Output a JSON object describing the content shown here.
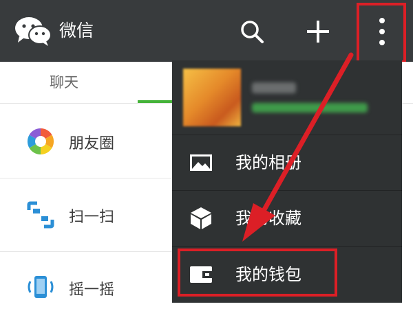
{
  "app": {
    "title": "微信"
  },
  "toolbar": {
    "icons": [
      "search-icon",
      "plus-icon",
      "more-vertical-icon"
    ]
  },
  "tabs": {
    "chat_label": "聊天"
  },
  "discover": {
    "items": [
      {
        "label": "朋友圈",
        "icon": "moments-icon"
      },
      {
        "label": "扫一扫",
        "icon": "scan-icon"
      },
      {
        "label": "摇一摇",
        "icon": "shake-icon"
      }
    ]
  },
  "menu": {
    "items": [
      {
        "label": "我的相册",
        "icon": "photo-album-icon"
      },
      {
        "label": "我的收藏",
        "icon": "favorites-cube-icon"
      },
      {
        "label": "我的钱包",
        "icon": "wallet-icon"
      }
    ]
  },
  "colors": {
    "appbar": "#383b3d",
    "menu": "#2f3233",
    "accent_green": "#45b339",
    "annotation_red": "#dc1f26"
  }
}
